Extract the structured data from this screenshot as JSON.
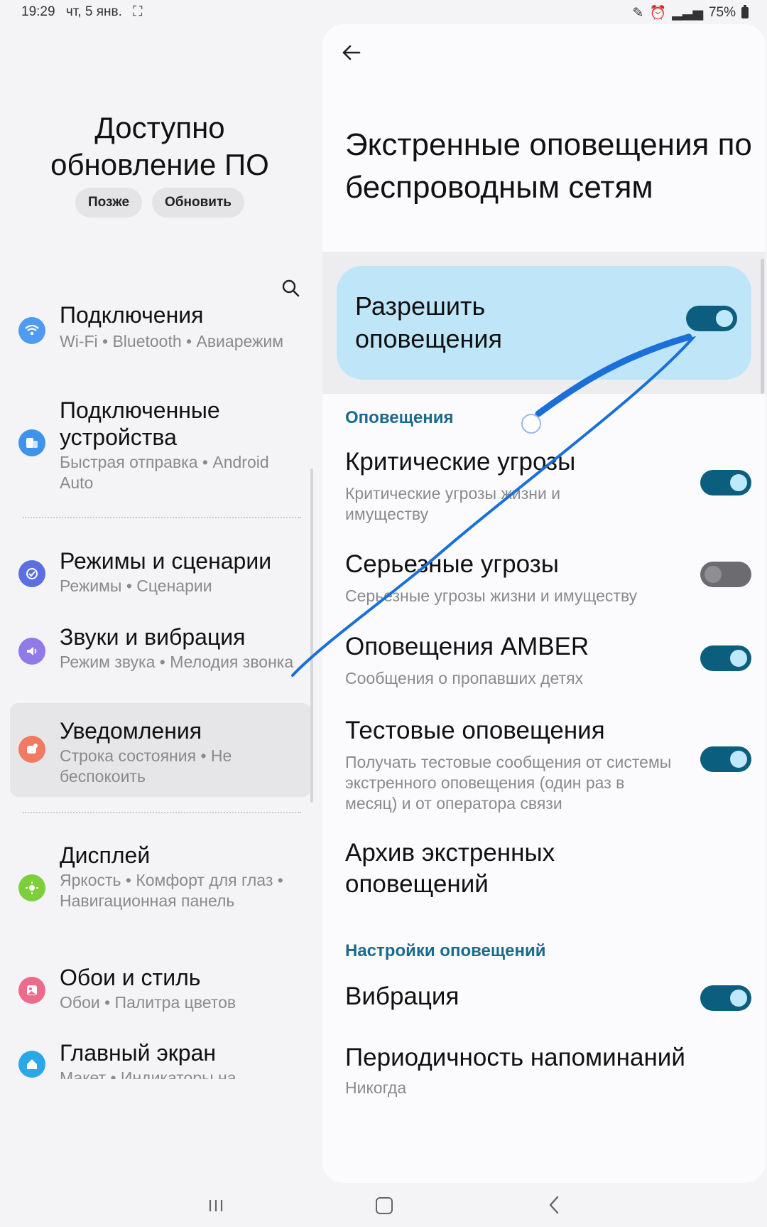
{
  "status": {
    "time": "19:29",
    "date": "чт, 5 янв.",
    "battery": "75%"
  },
  "update": {
    "title_line1": "Доступно",
    "title_line2": "обновление ПО",
    "later": "Позже",
    "update": "Обновить"
  },
  "menu": [
    {
      "title": "Подключения",
      "sub": "Wi-Fi  •  Bluetooth  •  Авиарежим",
      "icon": "wifi-icon",
      "color": "#4f9bf0"
    },
    {
      "title": "Подключенные устройства",
      "sub": "Быстрая отправка  •  Android Auto",
      "icon": "connected-devices-icon",
      "color": "#3e93ea"
    },
    {
      "title": "Режимы и сценарии",
      "sub": "Режимы  •  Сценарии",
      "icon": "modes-icon",
      "color": "#5b6fe0"
    },
    {
      "title": "Звуки и вибрация",
      "sub": "Режим звука  •  Мелодия звонка",
      "icon": "sound-icon",
      "color": "#8f7ae8"
    },
    {
      "title": "Уведомления",
      "sub": "Строка состояния  •  Не беспокоить",
      "icon": "notifications-icon",
      "color": "#f07a62"
    },
    {
      "title": "Дисплей",
      "sub": "Яркость  •  Комфорт для глаз  •  Навигационная панель",
      "icon": "display-icon",
      "color": "#7ccf3a"
    },
    {
      "title": "Обои и стиль",
      "sub": "Обои  •  Палитра цветов",
      "icon": "wallpaper-icon",
      "color": "#ec6b8a"
    },
    {
      "title": "Главный экран",
      "sub": "Макет  •  Индикаторы на",
      "icon": "home-screen-icon",
      "color": "#2aa7e8"
    }
  ],
  "detail": {
    "title": "Экстренные оповещения по беспроводным сетям",
    "master_label_line1": "Разрешить",
    "master_label_line2": "оповещения",
    "master_on": true,
    "section_alerts": "Оповещения",
    "rows": [
      {
        "title": "Критические угрозы",
        "sub": "Критические угрозы жизни и имуществу",
        "on": true
      },
      {
        "title": "Серьезные угрозы",
        "sub": "Серьезные угрозы жизни и имуществу",
        "on": false
      },
      {
        "title": "Оповещения AMBER",
        "sub": "Сообщения о пропавших детях",
        "on": true
      },
      {
        "title": "Тестовые оповещения",
        "sub": "Получать тестовые сообщения от системы экстренного оповещения (один раз в месяц) и от оператора связи",
        "on": true
      },
      {
        "title": "Архив экстренных оповещений",
        "sub": ""
      }
    ],
    "section_settings": "Настройки оповещений",
    "vibration": "Вибрация",
    "vibration_on": true,
    "reminder_title": "Периодичность напоминаний",
    "reminder_value": "Никогда"
  },
  "colors": {
    "accent": "#0c5e7f",
    "master_bg": "#bfe6f8",
    "section": "#1a6a8f",
    "annotation": "#1a6fd8"
  }
}
